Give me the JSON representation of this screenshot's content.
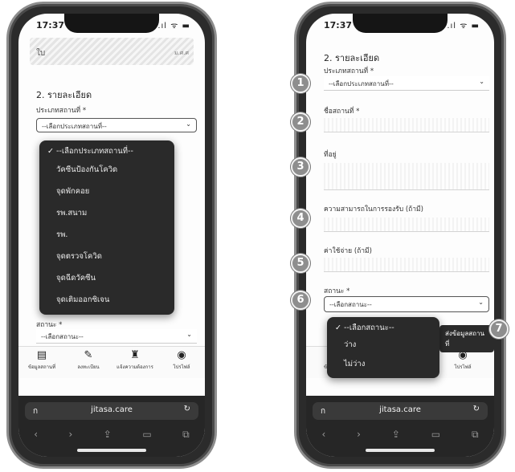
{
  "left_phone": {
    "status": {
      "time": "17:37",
      "icons": ".ıl ᯤ ▬"
    },
    "header": {
      "left": "ใบ",
      "right": "ม.ศ.ศ"
    },
    "section_title": "2. รายละเอียด",
    "place_type_label": "ประเภทสถานที่ *",
    "place_type_value": "--เลือกประเภทสถานที่--",
    "dropdown_options": [
      {
        "label": "--เลือกประเภทสถานที่--",
        "selected": true
      },
      {
        "label": "วัคซีนป้องกันโควิด",
        "selected": false
      },
      {
        "label": "จุดพักคอย",
        "selected": false
      },
      {
        "label": "รพ.สนาม",
        "selected": false
      },
      {
        "label": "รพ.",
        "selected": false
      },
      {
        "label": "จุดตรวจโควิด",
        "selected": false
      },
      {
        "label": "จุดฉีดวัคซีน",
        "selected": false
      },
      {
        "label": "จุดเติมออกซิเจน",
        "selected": false
      }
    ],
    "status_label": "สถานะ *",
    "status_value": "--เลือกสถานะ--",
    "tabbar": [
      {
        "icon": "▤",
        "label": "ข้อมูลสถานที่"
      },
      {
        "icon": "✎",
        "label": "ลงทะเบียน"
      },
      {
        "icon": "♜",
        "label": "แจ้งความต้องการ"
      },
      {
        "icon": "◉",
        "label": "โปรไฟล์"
      }
    ],
    "url": {
      "aa": "ก",
      "domain": "jitasa.care",
      "reload": "↻"
    },
    "browser_nav": [
      "‹",
      "›",
      "⇪",
      "▭",
      "⧉"
    ]
  },
  "right_phone": {
    "status": {
      "time": "17:37",
      "icons": ".ıl ᯤ ▬"
    },
    "section_title": "2. รายละเอียด",
    "place_type_label": "ประเภทสถานที่ *",
    "place_type_value": "--เลือกประเภทสถานที่--",
    "name_label": "ชื่อสถานที่ *",
    "address_label": "ที่อยู่",
    "capacity_label": "ความสามารถในการรองรับ (ถ้ามี)",
    "cost_label": "ค่าใช้จ่าย (ถ้ามี)",
    "status_label": "สถานะ *",
    "status_value": "--เลือกสถานะ--",
    "status_options": [
      {
        "label": "--เลือกสถานะ--",
        "selected": true
      },
      {
        "label": "ว่าง",
        "selected": false
      },
      {
        "label": "ไม่ว่าง",
        "selected": false
      }
    ],
    "submit_label": "ส่งข้อมูลสถานที่",
    "tabbar": [
      {
        "icon": "▤",
        "label": "ข้อมูลสถานที่"
      },
      {
        "icon": "◉",
        "label": "โปรไฟล์"
      }
    ],
    "url": {
      "aa": "ก",
      "domain": "jitasa.care",
      "reload": "↻"
    },
    "browser_nav": [
      "‹",
      "›",
      "⇪",
      "▭",
      "⧉"
    ]
  },
  "badges": [
    "1",
    "2",
    "3",
    "4",
    "5",
    "6",
    "7"
  ]
}
